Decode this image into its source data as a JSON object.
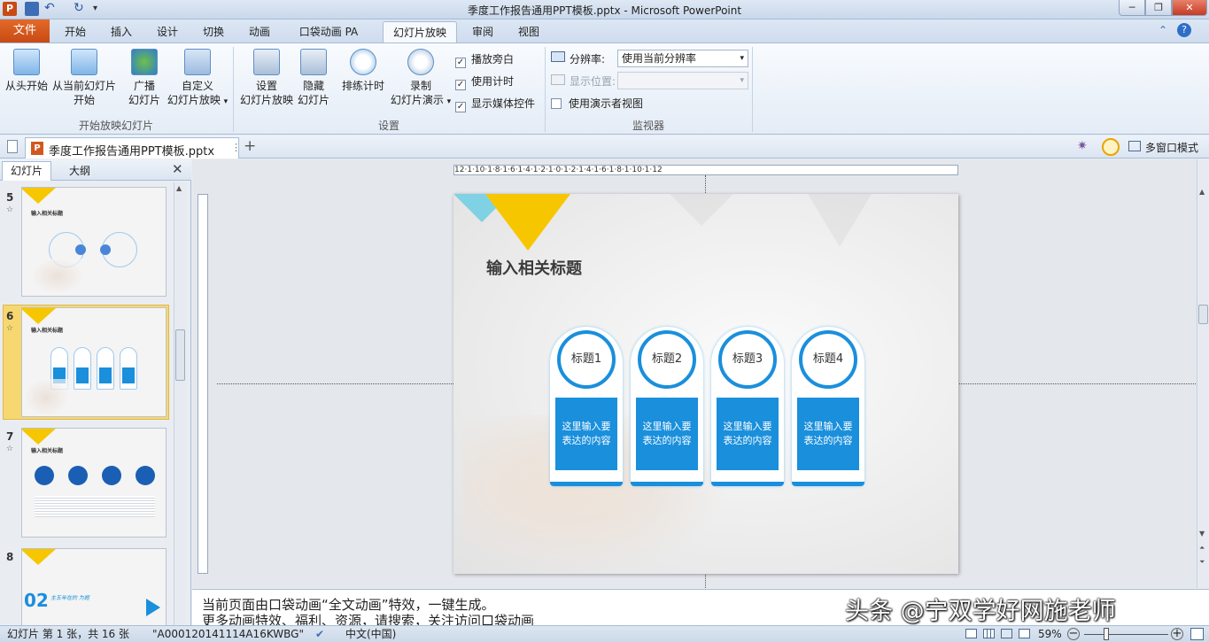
{
  "window": {
    "title": "季度工作报告通用PPT模板.pptx - Microsoft PowerPoint"
  },
  "tabs": [
    "开始",
    "插入",
    "设计",
    "切换",
    "动画",
    "口袋动画 PA",
    "幻灯片放映",
    "审阅",
    "视图"
  ],
  "file_tab": "文件",
  "active_tab": "幻灯片放映",
  "ribbon": {
    "group1": {
      "label": "开始放映幻灯片",
      "buttons": [
        {
          "line1": "从头开始",
          "line2": ""
        },
        {
          "line1": "从当前幻灯片",
          "line2": "开始"
        },
        {
          "line1": "广播",
          "line2": "幻灯片"
        },
        {
          "line1": "自定义",
          "line2": "幻灯片放映"
        }
      ]
    },
    "group2": {
      "label": "设置",
      "buttons": [
        {
          "line1": "设置",
          "line2": "幻灯片放映"
        },
        {
          "line1": "隐藏",
          "line2": "幻灯片"
        },
        {
          "line1": "排练计时",
          "line2": ""
        },
        {
          "line1": "录制",
          "line2": "幻灯片演示"
        }
      ],
      "checks": [
        {
          "label": "播放旁白",
          "checked": true
        },
        {
          "label": "使用计时",
          "checked": true
        },
        {
          "label": "显示媒体控件",
          "checked": true
        }
      ]
    },
    "group3": {
      "label": "监视器",
      "resolution_label": "分辨率:",
      "resolution_value": "使用当前分辨率",
      "display_label": "显示位置:",
      "presenter_view": "使用演示者视图"
    }
  },
  "doc_tab": {
    "name": "季度工作报告通用PPT模板.pptx",
    "multiwindow": "多窗口模式"
  },
  "panel_tabs": [
    "幻灯片",
    "大纲"
  ],
  "thumbnails": [
    {
      "num": "5",
      "title": "输入相关标题"
    },
    {
      "num": "6",
      "title": "输入相关标题"
    },
    {
      "num": "7",
      "title": "输入相关标题"
    },
    {
      "num": "8",
      "title": "主五年在的 为题",
      "big": "02"
    }
  ],
  "slide": {
    "title": "输入相关标题",
    "cards": [
      {
        "heading": "标题1",
        "body1": "这里输入要",
        "body2": "表达的内容"
      },
      {
        "heading": "标题2",
        "body1": "这里输入要",
        "body2": "表达的内容"
      },
      {
        "heading": "标题3",
        "body1": "这里输入要",
        "body2": "表达的内容"
      },
      {
        "heading": "标题4",
        "body1": "这里输入要",
        "body2": "表达的内容"
      }
    ]
  },
  "ruler_labels": "12·1·10·1·8·1·6·1·4·1·2·1·0·1·2·1·4·1·6·1·8·1·10·1·12",
  "notes": {
    "line1": "当前页面由口袋动画“全文动画”特效，一键生成。",
    "line2": "更多动画特效、福利、资源，请搜索，关注访问口袋动画"
  },
  "watermark": "头条 @宁双学好网施老师",
  "status": {
    "slide_info": "幻灯片 第 1 张，共 16 张",
    "theme": "\"A000120141114A16KWBG\"",
    "language": "中文(中国)",
    "zoom": "59%"
  },
  "colors": {
    "accent": "#1a8fdc",
    "file_tab": "#d2571e",
    "yellow": "#f6c700",
    "thumb_selected": "#f7d870"
  }
}
